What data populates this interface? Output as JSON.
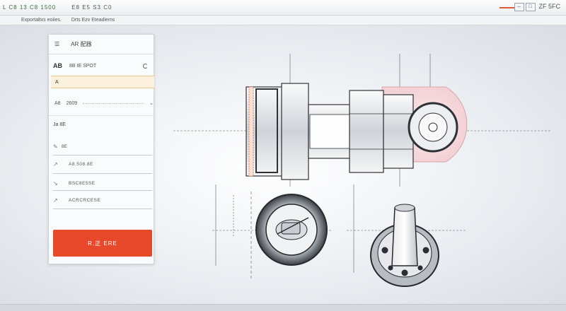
{
  "titlebar": {
    "app_title": "L C8 13 C8 1500",
    "doc_title": "E8 E5 S3 C0",
    "controls": [
      "–",
      "□"
    ],
    "corner_text": "ZF 5FC"
  },
  "menubar": {
    "items": [
      "Exportaltxs eoiies.",
      "Drts Ezv Eteadiems"
    ]
  },
  "panel": {
    "header_icon": "list-icon",
    "header_title": "AR 配器",
    "row_a_big": "AB",
    "row_a_text": "8B IE SPOT",
    "input_label": "A",
    "value_left": "A8",
    "value_mid": "2609",
    "section_label": "Ja 8E",
    "fields": [
      {
        "icon": "pencil-icon",
        "label": "8E",
        "value": ""
      },
      {
        "icon": "arrow-icon",
        "label": "",
        "value": "A8.508.8E"
      },
      {
        "icon": "arrow-icon",
        "label": "",
        "value": "BSC8E5SE"
      },
      {
        "icon": "arrow-icon",
        "label": "",
        "value": "ACRCRCESE"
      }
    ],
    "primary_button": "R.正 ERE"
  },
  "colors": {
    "accent": "#e8482a",
    "highlight_row": "#fbf1dc",
    "panel_bg": "#fafbfc"
  }
}
